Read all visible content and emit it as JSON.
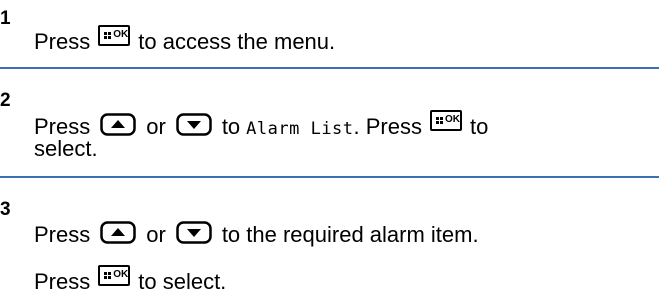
{
  "steps": [
    {
      "number": "1",
      "parts": {
        "press": "Press",
        "rest": "to access the menu."
      }
    },
    {
      "number": "2",
      "parts": {
        "press": "Press",
        "or": "or",
        "to": "to",
        "menu_item": "Alarm List",
        "after_item": ". Press",
        "to_end": "to",
        "line2": "select."
      }
    },
    {
      "number": "3",
      "parts": {
        "press": "Press",
        "or": "or",
        "rest": "to the required alarm item.",
        "press2": "Press",
        "rest2": "to select."
      }
    }
  ],
  "icons": {
    "ok_key_label": "OK",
    "up_key": "up-arrow-key",
    "down_key": "down-arrow-key",
    "menu_ok_key": "menu-ok-key"
  },
  "colors": {
    "divider": "#3d6fb4"
  }
}
